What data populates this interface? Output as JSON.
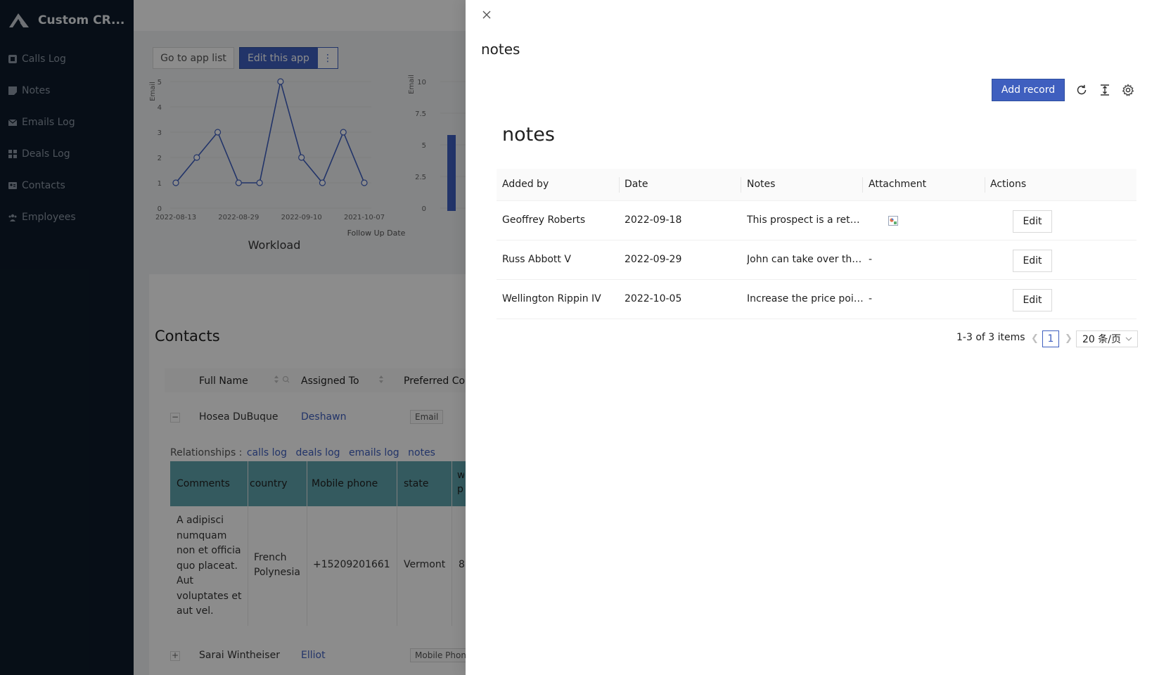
{
  "sidebar": {
    "app_name": "Custom CR...",
    "items": [
      {
        "label": "Calls Log"
      },
      {
        "label": "Notes"
      },
      {
        "label": "Emails Log"
      },
      {
        "label": "Deals Log"
      },
      {
        "label": "Contacts"
      },
      {
        "label": "Employees"
      }
    ]
  },
  "background": {
    "buttons": {
      "go_to_app_list": "Go to app list",
      "edit_this_app": "Edit this app",
      "more": "⋮"
    },
    "chart1": {
      "ylabel": "Email",
      "y_ticks": [
        "5",
        "4",
        "3",
        "2",
        "1",
        "0"
      ],
      "x_ticks": [
        "2022-08-13",
        "2022-08-29",
        "2022-09-10",
        "2021-10-07"
      ],
      "xlabel": "Follow Up Date",
      "title": "Workload"
    },
    "chart2": {
      "ylabel": "Email",
      "y_ticks": [
        "10",
        "7.5",
        "5",
        "2.5",
        "0"
      ]
    },
    "contacts": {
      "title": "Contacts",
      "columns": [
        "Full Name",
        "Assigned To",
        "Preferred Co"
      ],
      "rows": [
        {
          "expander": "−",
          "name": "Hosea DuBuque",
          "assigned": "Deshawn",
          "preferred": "Email"
        },
        {
          "expander": "+",
          "name": "Sarai Wintheiser",
          "assigned": "Elliot",
          "preferred": "Mobile Phon"
        }
      ],
      "relationships_label": "Relationships :",
      "relationships": [
        "calls log",
        "deals log",
        "emails log",
        "notes"
      ],
      "sub_columns": [
        "Comments",
        "country",
        "Mobile phone",
        "state",
        "w p"
      ],
      "sub_row": {
        "comments": "A adipisci numquam non et officia quo placeat. Aut voluptates et aut vel.",
        "country": "French Polynesia",
        "mobile": "+15209201661",
        "state": "Vermont",
        "extra": "8"
      }
    }
  },
  "chart_data": {
    "type": "line",
    "title": "Workload",
    "xlabel": "Follow Up Date",
    "ylabel": "Email",
    "x_tick_labels": [
      "2022-08-13",
      "2022-08-29",
      "2022-09-10",
      "2021-10-07"
    ],
    "values": [
      1,
      2,
      3,
      1,
      1,
      5,
      2,
      1,
      3,
      1
    ],
    "ylim": [
      0,
      5
    ]
  },
  "drawer": {
    "title": "notes",
    "add_record": "Add record",
    "block_title": "notes",
    "columns": [
      "Added by",
      "Date",
      "Notes",
      "Attachment",
      "Actions"
    ],
    "rows": [
      {
        "added_by": "Geoffrey Roberts",
        "date": "2022-09-18",
        "notes": "This prospect is a return...",
        "attachment": "",
        "action": "Edit"
      },
      {
        "added_by": "Russ Abbott V",
        "date": "2022-09-29",
        "notes": "John can take over this ...",
        "attachment": "-",
        "action": "Edit"
      },
      {
        "added_by": "Wellington Rippin IV",
        "date": "2022-10-05",
        "notes": "Increase the price point!",
        "attachment": "-",
        "action": "Edit"
      }
    ],
    "pagination": {
      "total": "1-3 of 3 items",
      "page": "1",
      "page_size": "20 条/页"
    }
  },
  "colors": {
    "sidebar_bg": "#0d1b2a",
    "primary": "#3f5fbf",
    "teal_header": "#5fa5ad"
  }
}
